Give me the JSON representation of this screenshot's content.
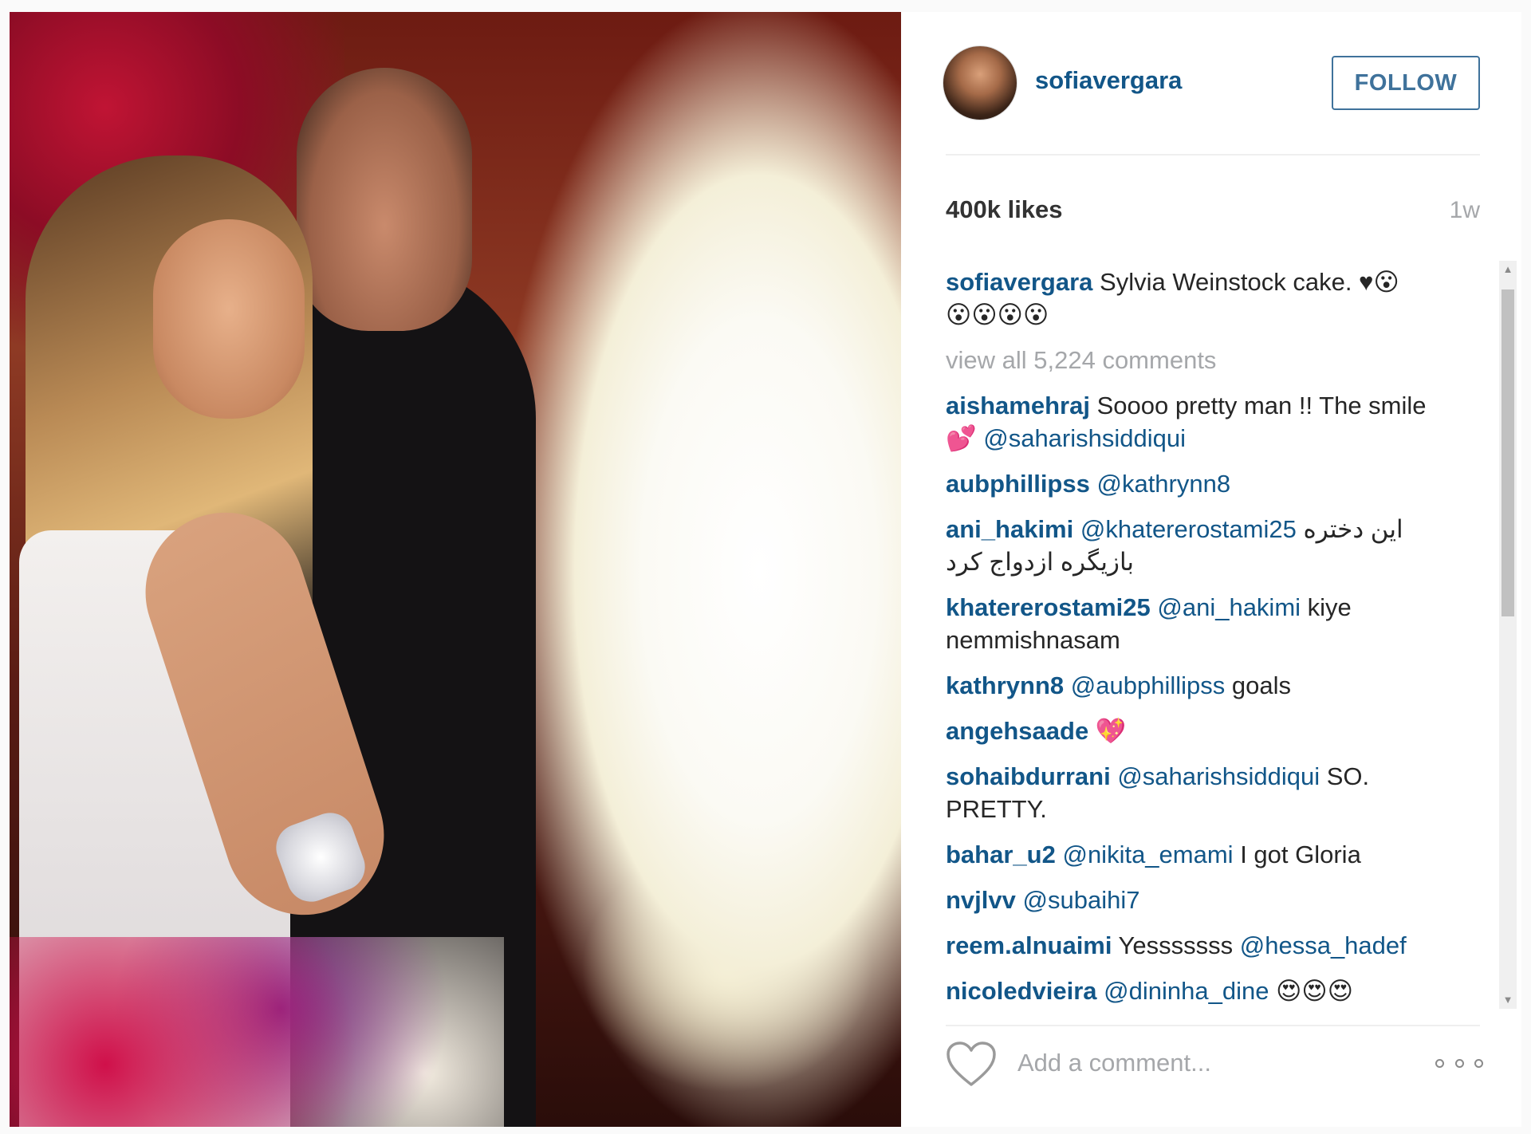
{
  "post": {
    "username": "sofiavergara",
    "follow_label": "FOLLOW",
    "likes": "400k likes",
    "time_ago": "1w"
  },
  "caption": {
    "user": "sofiavergara",
    "text": "Sylvia Weinstock cake. ♥😮",
    "text_line2": "😮😮😮😮"
  },
  "view_all": "view all 5,224 comments",
  "comments": [
    {
      "user": "aishamehraj",
      "text": "Soooo pretty man !! The smile 💕",
      "mention": "@saharishsiddiqui",
      "mention_after": "",
      "rtl": ""
    },
    {
      "user": "aubphillipss",
      "text": "",
      "mention": "@kathrynn8",
      "mention_after": "",
      "rtl": ""
    },
    {
      "user": "ani_hakimi",
      "text": "",
      "mention": "@khatererostami25",
      "mention_after": "",
      "rtl": "این دختره بازیگره ازدواج کرد"
    },
    {
      "user": "khatererostami25",
      "text": "",
      "mention": "@ani_hakimi",
      "mention_after": "kiye nemmishnasam",
      "rtl": ""
    },
    {
      "user": "kathrynn8",
      "text": "",
      "mention": "@aubphillipss",
      "mention_after": "goals",
      "rtl": ""
    },
    {
      "user": "angehsaade",
      "text": "💖",
      "mention": "",
      "mention_after": "",
      "rtl": ""
    },
    {
      "user": "sohaibdurrani",
      "text": "",
      "mention": "@saharishsiddiqui",
      "mention_after": "SO. PRETTY.",
      "rtl": ""
    },
    {
      "user": "bahar_u2",
      "text": "",
      "mention": "@nikita_emami",
      "mention_after": "I got Gloria",
      "rtl": ""
    },
    {
      "user": "nvjlvv",
      "text": "",
      "mention": "@subaihi7",
      "mention_after": "",
      "rtl": ""
    },
    {
      "user": "reem.alnuaimi",
      "text": "Yesssssss",
      "mention": "@hessa_hadef",
      "mention_after": "",
      "rtl": ""
    },
    {
      "user": "nicoledvieira",
      "text": "",
      "mention": "@dininha_dine",
      "mention_after": "😍😍😍",
      "rtl": ""
    }
  ],
  "footer": {
    "add_comment_placeholder": "Add a comment...",
    "like_icon": "heart-outline-icon",
    "more_icon": "more-options-icon"
  },
  "colors": {
    "link": "#125688",
    "follow_border": "#3f729b",
    "muted": "#a5a7aa",
    "text": "#262626"
  }
}
